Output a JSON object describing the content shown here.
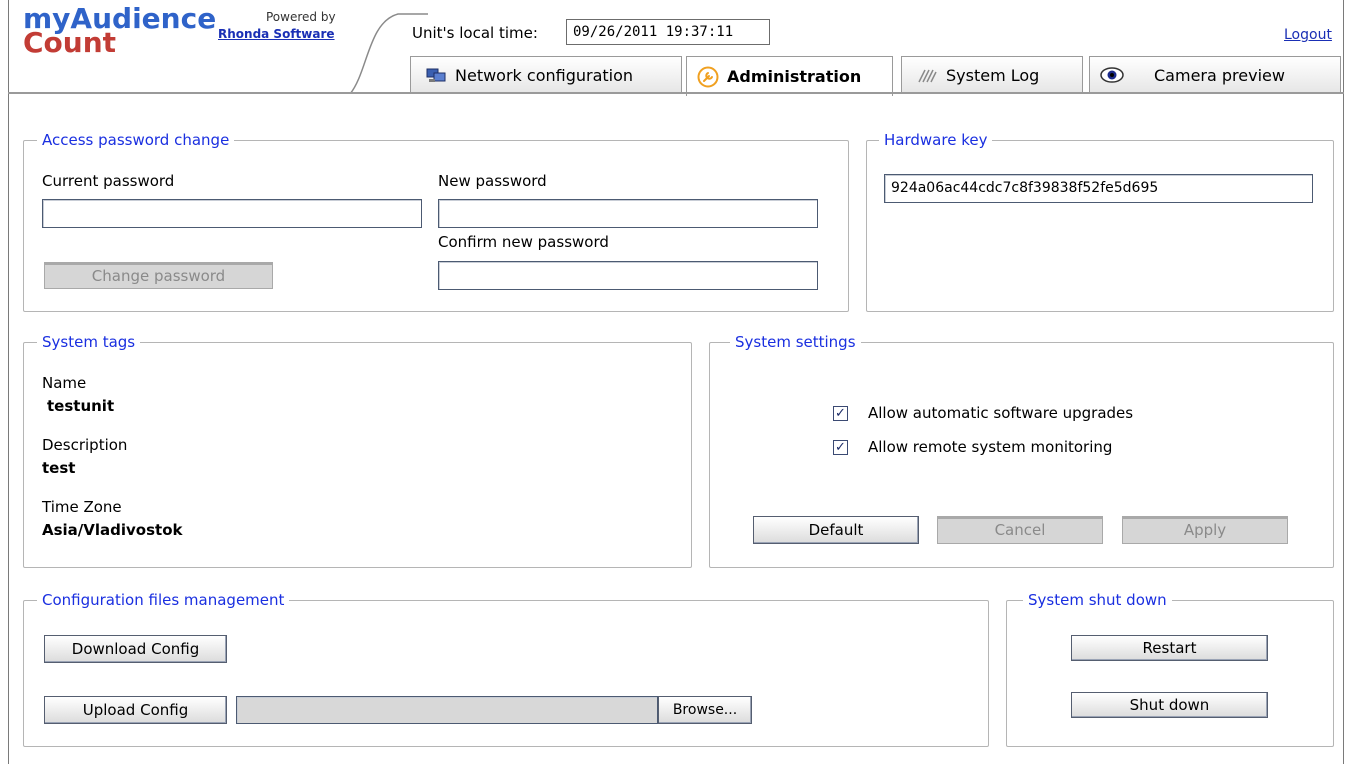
{
  "brand": {
    "line1": "myAudience",
    "line2": "Count",
    "powered_by": "Powered by",
    "vendor": "Rhonda Software"
  },
  "header": {
    "time_label": "Unit's local time:",
    "time_value": "09/26/2011 19:37:11",
    "logout": "Logout"
  },
  "tabs": [
    {
      "label": "Network configuration",
      "icon": "network-icon",
      "active": false
    },
    {
      "label": "Administration",
      "icon": "wrench-icon",
      "active": true
    },
    {
      "label": "System Log",
      "icon": "log-icon",
      "active": false
    },
    {
      "label": "Camera preview",
      "icon": "eye-icon",
      "active": false
    }
  ],
  "password": {
    "legend": "Access password change",
    "current_label": "Current password",
    "current_value": "",
    "new_label": "New password",
    "new_value": "",
    "confirm_label": "Confirm new password",
    "confirm_value": "",
    "change_button": "Change password"
  },
  "hardware": {
    "legend": "Hardware key",
    "key": "924a06ac44cdc7c8f39838f52fe5d695"
  },
  "tags": {
    "legend": "System tags",
    "name_label": "Name",
    "name_value": "testunit",
    "desc_label": "Description",
    "desc_value": "test",
    "tz_label": "Time Zone",
    "tz_value": "Asia/Vladivostok"
  },
  "settings": {
    "legend": "System settings",
    "upgrades_label": "Allow automatic software upgrades",
    "upgrades_checked": true,
    "monitoring_label": "Allow remote system monitoring",
    "monitoring_checked": true,
    "default_button": "Default",
    "cancel_button": "Cancel",
    "apply_button": "Apply"
  },
  "config": {
    "legend": "Configuration files management",
    "download_button": "Download Config",
    "upload_button": "Upload Config",
    "file_value": "",
    "browse_button": "Browse..."
  },
  "shutdown": {
    "legend": "System shut down",
    "restart_button": "Restart",
    "shutdown_button": "Shut down"
  },
  "colors": {
    "legend_blue": "#1a2fe0",
    "brand_blue": "#2f63c9",
    "brand_red": "#c23c35",
    "tab_icon_orange": "#f0a020"
  }
}
